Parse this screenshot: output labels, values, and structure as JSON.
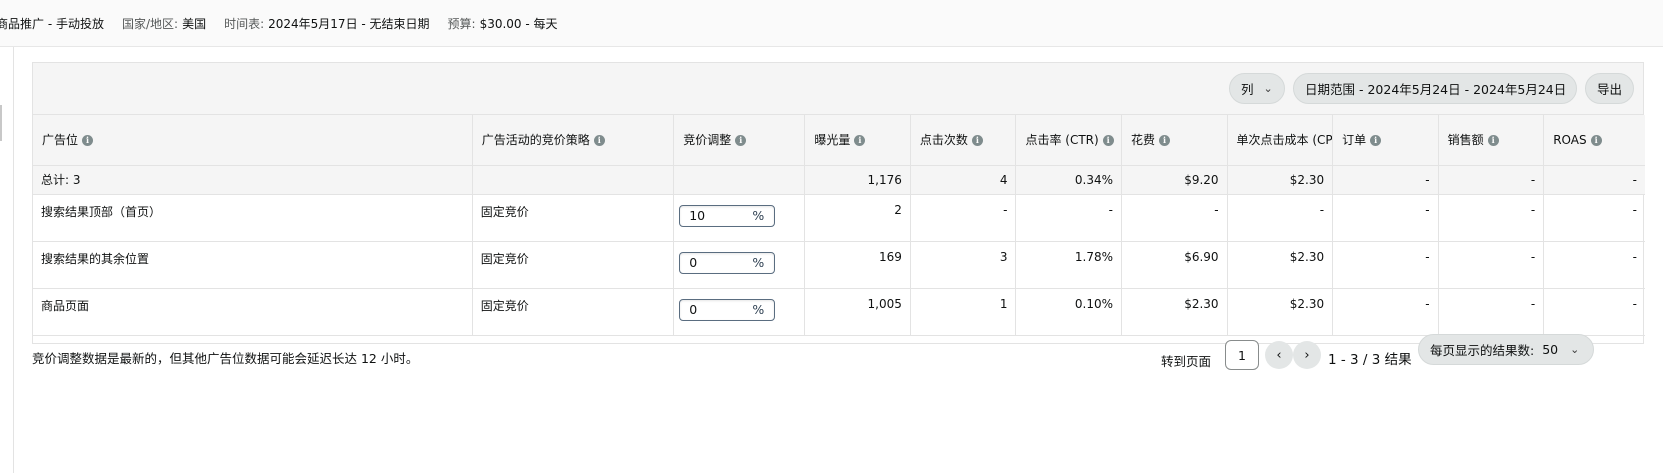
{
  "header": {
    "campaign": "商品推广 - 手动投放",
    "country_label": "国家/地区:",
    "country_value": "美国",
    "schedule_label": "时间表:",
    "schedule_value": "2024年5月17日 - 无结束日期",
    "budget_label": "预算:",
    "budget_value": "$30.00 - 每天"
  },
  "toolbar": {
    "columns_label": "列",
    "date_range_label": "日期范围 - 2024年5月24日 - 2024年5月24日",
    "export_label": "导出"
  },
  "table": {
    "columns": [
      "广告位",
      "广告活动的竞价策略",
      "竞价调整",
      "曝光量",
      "点击次数",
      "点击率 (CTR)",
      "花费",
      "单次点击成本 (CPC)",
      "订单",
      "销售额",
      "ROAS"
    ],
    "total": {
      "label": "总计: 3",
      "strategy": "",
      "bid": "",
      "impressions": "1,176",
      "clicks": "4",
      "ctr": "0.34%",
      "spend": "$9.20",
      "cpc": "$2.30",
      "orders": "-",
      "sales": "-",
      "roas": "-"
    },
    "rows": [
      {
        "placement": "搜索结果顶部（首页）",
        "strategy": "固定竞价",
        "bid_value": "10",
        "bid_unit": "%",
        "impressions": "2",
        "clicks": "-",
        "ctr": "-",
        "spend": "-",
        "cpc": "-",
        "orders": "-",
        "sales": "-",
        "roas": "-"
      },
      {
        "placement": "搜索结果的其余位置",
        "strategy": "固定竞价",
        "bid_value": "0",
        "bid_unit": "%",
        "impressions": "169",
        "clicks": "3",
        "ctr": "1.78%",
        "spend": "$6.90",
        "cpc": "$2.30",
        "orders": "-",
        "sales": "-",
        "roas": "-"
      },
      {
        "placement": "商品页面",
        "strategy": "固定竞价",
        "bid_value": "0",
        "bid_unit": "%",
        "impressions": "1,005",
        "clicks": "1",
        "ctr": "0.10%",
        "spend": "$2.30",
        "cpc": "$2.30",
        "orders": "-",
        "sales": "-",
        "roas": "-"
      }
    ]
  },
  "footer": {
    "note": "竞价调整数据是最新的，但其他广告位数据可能会延迟长达 12 小时。",
    "goto_label": "转到页面",
    "page_value": "1",
    "range": "1 - 3 / 3 结果",
    "per_page_label": "每页显示的结果数:",
    "per_page_value": "50"
  },
  "icons": {
    "info": "info-icon",
    "chevron_down": "chevron-down-icon",
    "chevron_left": "chevron-left-icon",
    "chevron_right": "chevron-right-icon"
  }
}
